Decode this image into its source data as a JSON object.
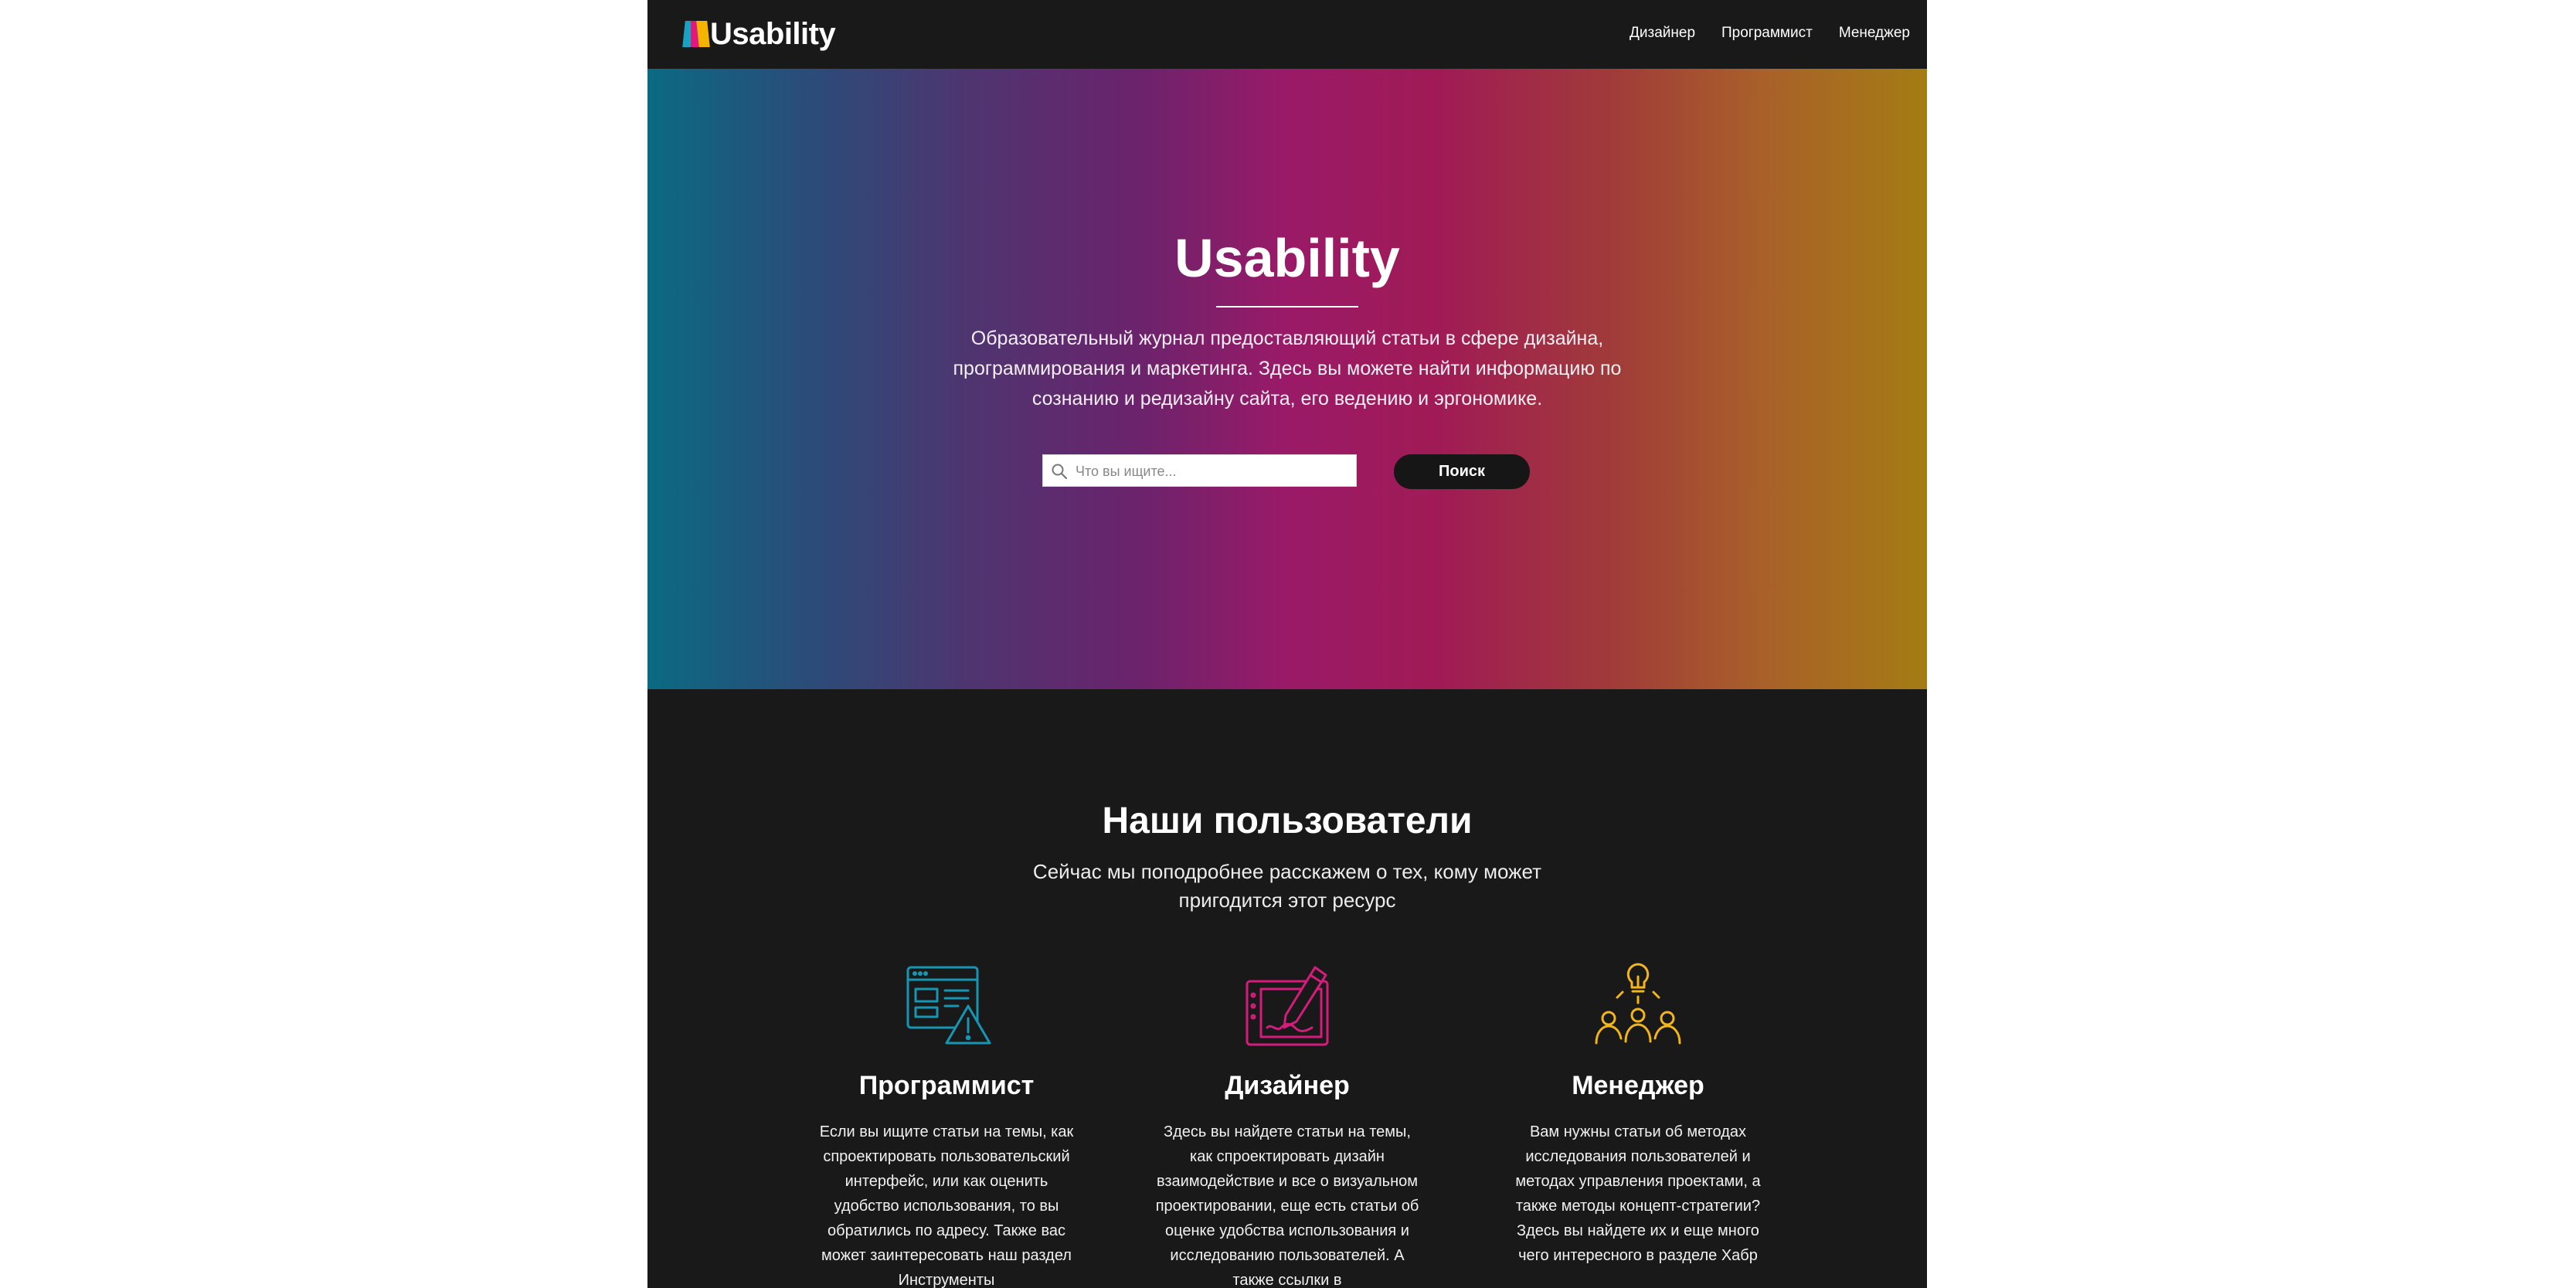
{
  "brand": {
    "name": "Usability",
    "colors": [
      "#1aa0c0",
      "#e0197d",
      "#f4b400"
    ]
  },
  "nav": {
    "items": [
      "Дизайнер",
      "Программист",
      "Менеджер"
    ]
  },
  "hero": {
    "title": "Usability",
    "description": "Образовательный журнал предоставляющий статьи в сфере дизайна, программирования и маркетинга. Здесь вы можете найти информацию по сознанию и редизайну сайта, его ведению и эргономике.",
    "search": {
      "placeholder": "Что вы ищите...",
      "value": "",
      "icon": "search-icon"
    },
    "search_button": "Поиск"
  },
  "users": {
    "title": "Наши пользователи",
    "subtitle": "Сейчас мы поподробнее расскажем о тех, кому может пригодится этот ресурс",
    "cards": [
      {
        "icon": "interface-warning-icon",
        "color": "#1596b3",
        "title": "Программист",
        "text": "Если вы ищите статьи на темы, как спроектировать пользовательский интерфейс, или как оценить удобство использования, то вы обратились по адресу. Также вас может заинтересовать наш раздел Инструменты"
      },
      {
        "icon": "drawing-tablet-icon",
        "color": "#d41c7c",
        "title": "Дизайнер",
        "text": "Здесь вы найдете статьи на темы, как спроектировать дизайн взаимодействие и все о визуальном проектировании, еще есть статьи об оценке удобства использования и исследованию пользователей. А также ссылки в"
      },
      {
        "icon": "idea-team-icon",
        "color": "#f2b51a",
        "title": "Менеджер",
        "text": "Вам нужны статьи об методах исследования пользователей и методах управления проектами, а также методы концепт-стратегии? Здесь вы найдете их и еще много чего интересного в разделе Хабр"
      }
    ]
  }
}
